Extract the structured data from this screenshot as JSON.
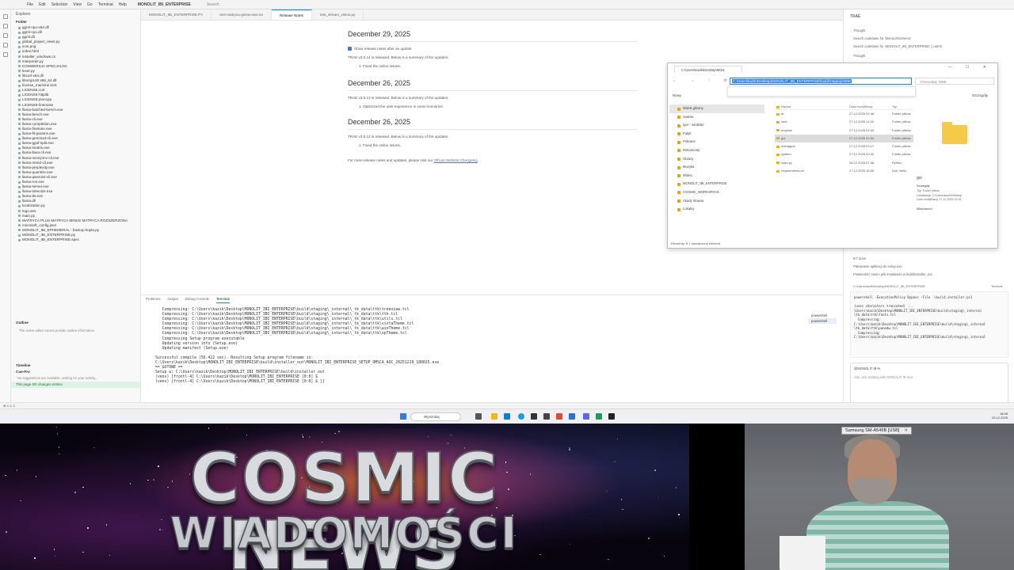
{
  "titlebar": {
    "menu": [
      "File",
      "Edit",
      "Selection",
      "View",
      "Go",
      "Terminal",
      "Help"
    ],
    "project": "MONOLIT_IBI_ENTERPRISE",
    "search": "Search"
  },
  "explorer": {
    "title": "Explorer",
    "folder": "Folder",
    "files": [
      "ggml-cpu-x64.dll",
      "ggml-cpu.dll",
      "ggml.dll",
      "global_project_reset.py",
      "icon.png",
      "index.html",
      "installer_windows.cs",
      "interpreter.py",
      "KONWERSJA SPECJALNA",
      "lexer.py",
      "libcurl-x64.dll",
      "libomp140.x86_64.dll",
      "license_machine.lock",
      "LICENSE.curl",
      "LICENSE-httplib",
      "LICENSE-jsoncpp",
      "LICENSE-linenoise",
      "llama-batched-bench.exe",
      "llama-bench.exe",
      "llama-cli.exe",
      "llama-completion.exe",
      "llama-finetune.exe",
      "llama-fit-params.exe",
      "llama-gemma3-cli.exe",
      "llama-gguf-split.exe",
      "llama-imatrix.exe",
      "llama-llava-cli.exe",
      "llama-minicpmv-cli.exe",
      "llama-mtmd-cli.exe",
      "llama-perplexity.exe",
      "llama-quantize.exe",
      "llama-qwen2vl-cli.exe",
      "llama-run.exe",
      "llama-server.exe",
      "llama-tokenize.exe",
      "llama-tts.exe",
      "llama.dll",
      "localization.py",
      "logo.ans",
      "main.py",
      "MATRYCA PLUS MATRYCA MINUS MATRYCA ROZSZERZONA",
      "microsoft_config.json",
      "MONOLIT_IBI_EPHEMERAL - backup kopia.py",
      "MONOLIT_IBI_ENTERPRISE.py",
      "MONOLIT_IBI_ENTERPRISE.spec"
    ],
    "outline": "Outline",
    "outline_msg": "The active editor cannot provide outline information.",
    "timeline": "Timeline",
    "cue": "Cue-Pro",
    "cue_msg": "No suggestions are available, waiting for your activity...",
    "green": "This page 0/0 changes entries"
  },
  "tabs": [
    "MONOLIT_IBI_ENTERPRISE.PY",
    "test-matryca-gniew.ewe.txt",
    "Release Notes",
    "test_stream_vision.py"
  ],
  "release_notes": {
    "h1": "December 29, 2025",
    "show_label": "Show release notes after an update",
    "p1": "TRAE v3.5.14 is released. Below is a summary of the updates.",
    "li1": "1. Fixed the online issues.",
    "h2": "December 26, 2025",
    "p2": "TRAE v3.5.13 is released. Below is a summary of the updates.",
    "li2": "1. Optimized the user experience in some scenarios.",
    "h3": "December 26, 2025",
    "p3": "TRAE v3.5.12 is released. Below is a summary of the updates.",
    "li3": "1. Fixed the online issues.",
    "more": "For more release notes and updates, please visit our",
    "more_link": "Official Website Changelog"
  },
  "dialog": {
    "tab": "C:\\Users\\kazik\\Desktop\\MON",
    "address": "C:\\Users\\kazik\\Desktop\\MONOLIT_IBI_ENTERPRISE\\build\\staging\\INNE",
    "search": "Przeszukaj: INNE",
    "new": "Nowy",
    "view": "Szczegóły",
    "nav": [
      "Widok główny",
      "Galeria",
      "Igor - osobiste",
      "Pulpit",
      "Pobrane",
      "Dokumenty",
      "Obrazy",
      "Muzyka",
      "Wideo",
      "MONOLIT_IBI_ENTERPRISE",
      "COSMIC_WORKSPACE",
      "Akady ntowna",
      "Lokalny"
    ],
    "headers": [
      "Nazwa",
      "Data modyfikacji",
      "Typ"
    ],
    "rows": [
      {
        "name": "ai",
        "date": "27.12.2025 02:46",
        "type": "Folder plików"
      },
      {
        "name": "core",
        "date": "27.12.2025 14:22",
        "type": "Folder plików"
      },
      {
        "name": "engines",
        "date": "27.12.2025 02:44",
        "type": "Folder plików"
      },
      {
        "name": "gui",
        "date": "27.12.2025 02:34",
        "type": "Folder plików"
      },
      {
        "name": "managers",
        "date": "27.12.2025 03:17",
        "type": "Folder plików"
      },
      {
        "name": "system",
        "date": "27.12.2025 02:42",
        "type": "Folder plików"
      },
      {
        "name": "main.py",
        "date": "28.12.2025 07:46",
        "type": "Python"
      },
      {
        "name": "requirements.txt",
        "date": "27.12.2025 16:06",
        "type": "Dok. tekst."
      }
    ],
    "preview_title": "gui",
    "preview_sub": "Szczegóły",
    "preview_meta": [
      "Typ: Folder plików",
      "Lokalizacja: C:\\Users\\kazik\\Desktop",
      "Data modyfikacji: 27.12.2025 02:34"
    ],
    "share": "Właściwości",
    "status": "Elementy: 8    1 zaznaczony element"
  },
  "right": {
    "title": "TRAE",
    "items": [
      "Thought",
      "Search codebase for 'MonoLithicDemo'",
      "Search codebase for 'MONOLIT_IBI_ENTERPRISE' | Latest",
      "Thought",
      "8/7 done",
      "Pakowanie aplikacji do setup.exe",
      "Potwierdzić zanim plik instalatora w build/installer_out"
    ],
    "term_path": "C:\\Users\\kazik\\Desktop\\MONOLIT_IBI_ENTERPRISE",
    "term_badge": "Terminal",
    "term_lines": [
      "powershell -ExecutionPolicy Bypass -File .\\build_installer.ps1",
      "",
      "(uses characters truncated) ...",
      "\\Users\\kazik\\Desktop\\MONOLIT_IBI_ENTERPRISE\\build\\staging\\_internal",
      "\\tk_data\\ttk\\fonts.tcl",
      "  Compressing:",
      "C:\\Users\\kazik\\Desktop\\MONOLIT_IBI_ENTERPRISE\\build\\staging\\_internal",
      "\\tk_data\\ttk\\panedw.tcl",
      "  Compressing:",
      "C:\\Users\\kazik\\Desktop\\MONOLIT_IBI_ENTERPRISE\\build\\staging\\_internal"
    ],
    "chat_user": "@MONOLIT IB %",
    "chat_placeholder": "Ask, ask chatting with MONOLIT IB now"
  },
  "terminal": {
    "tabs": [
      "Problems",
      "Output",
      "Debug Console",
      "Terminal"
    ],
    "lines": [
      "   Compressing: C:\\Users\\kazik\\Desktop\\MONOLIT_IBI_ENTERPRISE\\build\\staging\\_internal\\_tk_data\\ttk\\treeview.tcl",
      "   Compressing: C:\\Users\\kazik\\Desktop\\MONOLIT_IBI_ENTERPRISE\\build\\staging\\_internal\\_tk_data\\ttk\\ttk.tcl",
      "   Compressing: C:\\Users\\kazik\\Desktop\\MONOLIT_IBI_ENTERPRISE\\build\\staging\\_internal\\_tk_data\\ttk\\utils.tcl",
      "   Compressing: C:\\Users\\kazik\\Desktop\\MONOLIT_IBI_ENTERPRISE\\build\\staging\\_internal\\_tk_data\\ttk\\vistaTheme.tcl",
      "   Compressing: C:\\Users\\kazik\\Desktop\\MONOLIT_IBI_ENTERPRISE\\build\\staging\\_internal\\_tk_data\\ttk\\winTheme.tcl",
      "   Compressing: C:\\Users\\kazik\\Desktop\\MONOLIT_IBI_ENTERPRISE\\build\\staging\\_internal\\_tk_data\\ttk\\xpTheme.tcl",
      "   Compressing Setup program executable",
      "   Updating version info (Setup.exe)",
      "   Updating manifest (Setup.exe)",
      "",
      "Successful compile (56.422 sec). Resulting Setup program filename is:",
      "C:\\Users\\kazik\\Desktop\\MONOLIT_IBI_ENTERPRISE\\build\\installer_out\\MONOLIT_IBI_ENTERPRISE_SETUP_OMSCA_AOC_20251229_180025.exe",
      "== GOTOWE ==",
      "Setup w: C:\\Users\\kazik\\Desktop\\MONOLIT_IBI_ENTERPRISE\\build\\installer_out",
      "(venv) [frontl-4] C:\\Users\\kazik\\Desktop\\MONOLIT_IBI_ENTERPRISE [0:0] $",
      "(venv) [frontl-4] C:\\Users\\kazik\\Desktop\\MONOLIT_IBI_ENTERPRISE [0:0] $ []"
    ],
    "sessions": [
      "powershell",
      "powershell"
    ]
  },
  "statusbar": "⊗ 0 ⚠ 0",
  "taskbar": {
    "search": "Wyszukaj",
    "time": "18:08",
    "date": "29.12.2025"
  },
  "stream": {
    "title1": "COSMIC NEWS",
    "title2": "WIADOMOŚCI",
    "cam_label": "Samsung SM-A546B [USB]",
    "cam_close": "✕"
  }
}
